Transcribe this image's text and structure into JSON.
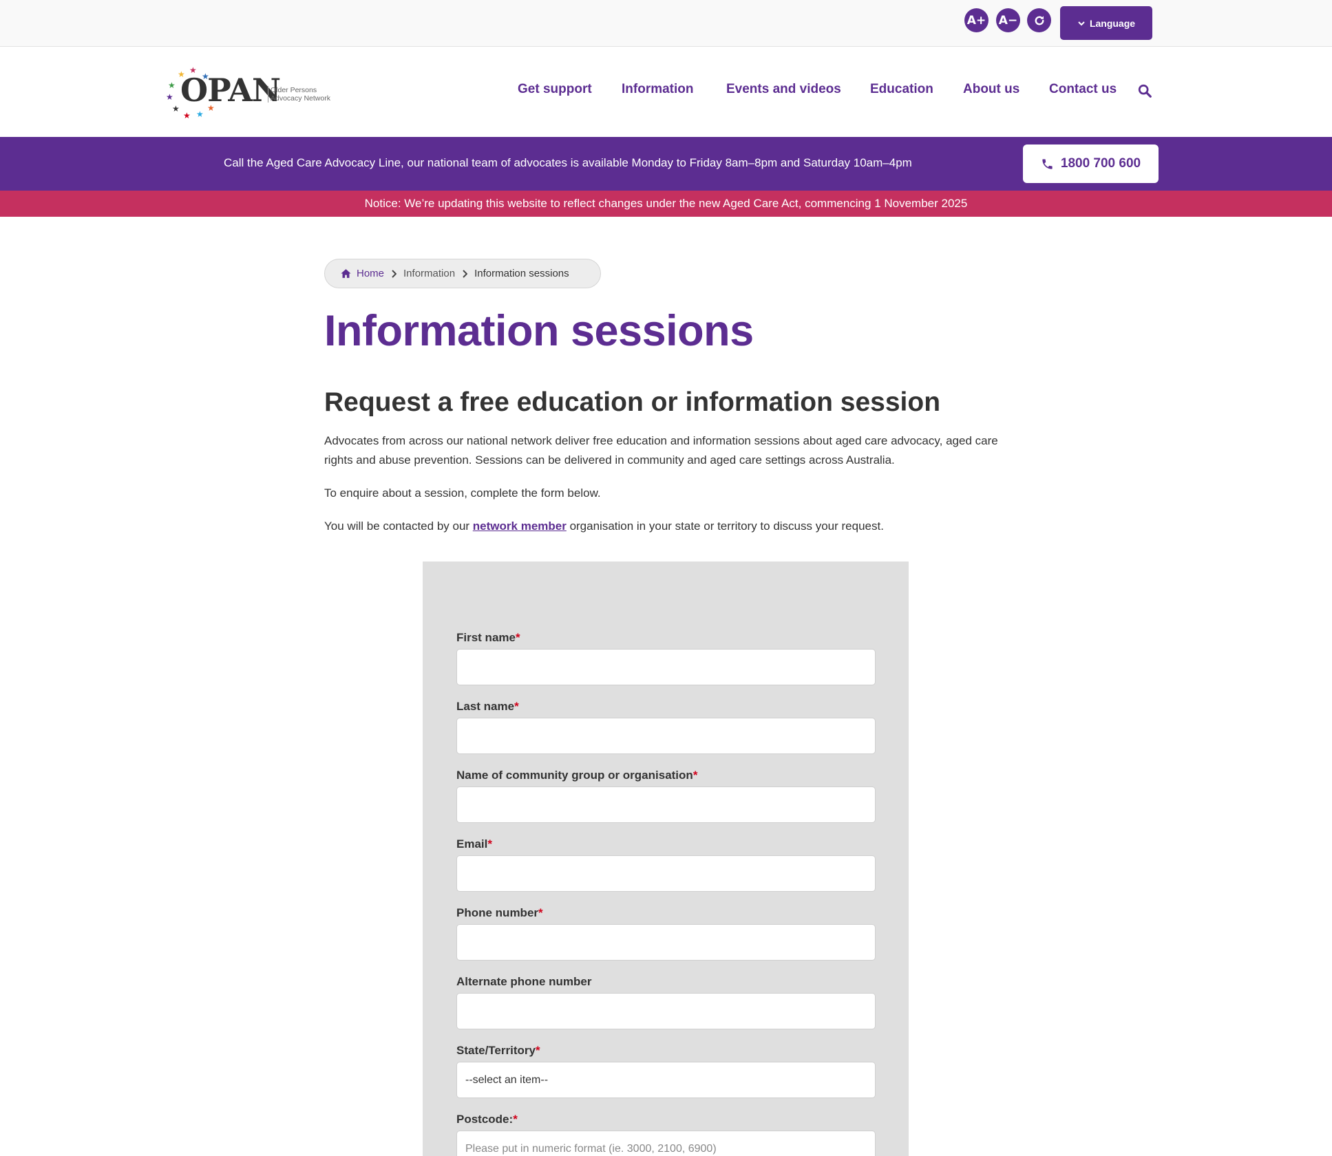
{
  "utility": {
    "font_increase": "A+",
    "font_decrease": "A−",
    "language_label": "Language"
  },
  "logo": {
    "word": "OPAN",
    "tagline_line1": "Older Persons",
    "tagline_line2": "Advocacy Network"
  },
  "nav": {
    "items": [
      "Get support",
      "Information",
      "Events and videos",
      "Education",
      "About us",
      "Contact us"
    ]
  },
  "call_banner": {
    "text": "Call the Aged Care Advocacy Line, our national team of advocates is available Monday to Friday 8am–8pm and Saturday 10am–4pm",
    "phone": "1800 700 600"
  },
  "notice": {
    "text": "Notice: We’re updating this website to reflect changes under the new Aged Care Act, commencing 1 November 2025"
  },
  "breadcrumb": {
    "home": "Home",
    "parent": "Information",
    "current": "Information sessions"
  },
  "page": {
    "title": "Information sessions",
    "subtitle": "Request a free education or information session",
    "intro": "Advocates from across our national network deliver free education and information sessions about aged care advocacy, aged care rights and abuse prevention. Sessions can be delivered in community and aged care settings across Australia.",
    "enquire": "To enquire about a session, complete the form below.",
    "contact_prefix": "You will be contacted by our ",
    "contact_link": "network member",
    "contact_suffix": " organisation in your state or territory to discuss your request."
  },
  "form": {
    "first_name": {
      "label": "First name",
      "required": "*",
      "value": ""
    },
    "last_name": {
      "label": "Last name",
      "required": "*",
      "value": ""
    },
    "organisation": {
      "label": "Name of community group or organisation",
      "required": "*",
      "value": ""
    },
    "email": {
      "label": "Email",
      "required": "*",
      "value": ""
    },
    "phone": {
      "label": "Phone number",
      "required": "*",
      "value": ""
    },
    "alt_phone": {
      "label": "Alternate phone number",
      "value": ""
    },
    "state": {
      "label": "State/Territory",
      "required": "*",
      "selected": "--select an item--"
    },
    "postcode": {
      "label": "Postcode:",
      "required": "*",
      "placeholder": "Please put in numeric format (ie. 3000, 2100, 6900)"
    }
  },
  "colors": {
    "brand_purple": "#5c2d91",
    "notice_pink": "#c5305f",
    "form_bg": "#dfdfdf",
    "required_red": "#d0021b"
  },
  "icons": [
    "rotate-icon",
    "chevron-down-icon",
    "search-icon",
    "phone-icon",
    "home-icon",
    "chevron-right-icon",
    "star-icon"
  ]
}
